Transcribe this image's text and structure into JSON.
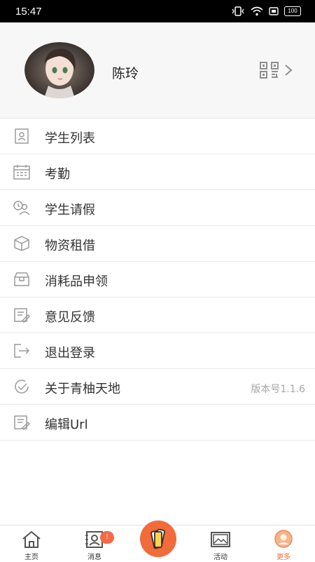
{
  "status_bar": {
    "time": "15:47",
    "battery": "100"
  },
  "profile": {
    "name": "陈玲",
    "avatar_icon": "user-avatar",
    "qr_icon": "qr-code-icon",
    "chevron_icon": "chevron-right-icon"
  },
  "menu": [
    {
      "label": "学生列表",
      "icon": "student-list-icon"
    },
    {
      "label": "考勤",
      "icon": "attendance-icon"
    },
    {
      "label": "学生请假",
      "icon": "student-leave-icon"
    },
    {
      "label": "物资租借",
      "icon": "supplies-rental-icon"
    },
    {
      "label": "消耗品申领",
      "icon": "consumables-request-icon"
    },
    {
      "label": "意见反馈",
      "icon": "feedback-icon"
    },
    {
      "label": "退出登录",
      "icon": "logout-icon"
    },
    {
      "label": "关于青柚天地",
      "icon": "about-icon",
      "extra": "版本号1.1.6"
    },
    {
      "label": "编辑Url",
      "icon": "edit-url-icon"
    }
  ],
  "tabbar": {
    "home": "主页",
    "messages": "消息",
    "messages_badge": "!",
    "activity": "活动",
    "more": "更多",
    "accent_color": "#f26b3a"
  }
}
